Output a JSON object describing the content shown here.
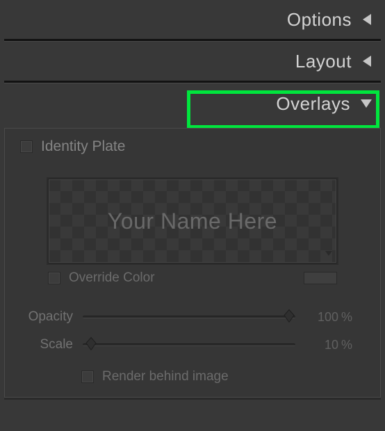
{
  "panels": {
    "options": {
      "label": "Options"
    },
    "layout": {
      "label": "Layout"
    },
    "overlays": {
      "label": "Overlays"
    }
  },
  "identity_plate": {
    "checkbox_label": "Identity Plate",
    "placeholder": "Your Name Here",
    "override_label": "Override Color",
    "override_color": "#4c4c4c"
  },
  "sliders": {
    "opacity": {
      "label": "Opacity",
      "value": "100",
      "unit": "%",
      "position_pct": 97
    },
    "scale": {
      "label": "Scale",
      "value": "10",
      "unit": "%",
      "position_pct": 4
    }
  },
  "render_behind": {
    "label": "Render behind image"
  }
}
